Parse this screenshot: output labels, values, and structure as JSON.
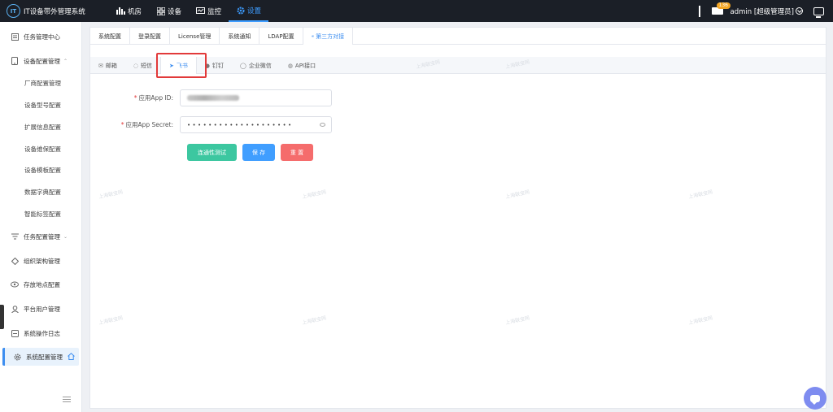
{
  "app": {
    "title": "IT设备带外管理系统",
    "logo": "IT"
  },
  "nav": [
    {
      "label": "机房",
      "icon": "bar-chart-icon"
    },
    {
      "label": "设备",
      "icon": "grid-icon"
    },
    {
      "label": "监控",
      "icon": "monitor-icon"
    },
    {
      "label": "设置",
      "icon": "gear-icon"
    }
  ],
  "header": {
    "badge": "136",
    "user": "admin [超级管理员]"
  },
  "sidebar": {
    "items": [
      {
        "label": "任务管理中心",
        "icon": "task-icon"
      },
      {
        "label": "设备配置管理",
        "icon": "device-icon"
      },
      {
        "label": "厂商配置管理"
      },
      {
        "label": "设备型号配置"
      },
      {
        "label": "扩展信息配置"
      },
      {
        "label": "设备维保配置"
      },
      {
        "label": "设备模板配置"
      },
      {
        "label": "数据字典配置"
      },
      {
        "label": "智能标签配置"
      },
      {
        "label": "任务配置管理",
        "icon": "filter-icon"
      },
      {
        "label": "组织架构管理",
        "icon": "org-icon"
      },
      {
        "label": "存放地点配置",
        "icon": "location-icon"
      },
      {
        "label": "平台用户管理",
        "icon": "user-icon"
      },
      {
        "label": "系统操作日志",
        "icon": "log-icon"
      },
      {
        "label": "系统配置管理",
        "icon": "settings-icon"
      }
    ]
  },
  "tabs_primary": [
    "系统配置",
    "登录配置",
    "License管理",
    "系统通知",
    "LDAP配置",
    "第三方对接"
  ],
  "tabs_secondary": [
    {
      "label": "邮箱",
      "icon": "mail-icon"
    },
    {
      "label": "短信",
      "icon": "sms-icon"
    },
    {
      "label": "飞书",
      "icon": "paper-plane-icon"
    },
    {
      "label": "钉钉",
      "icon": "dingtalk-icon"
    },
    {
      "label": "企业微信",
      "icon": "wecom-icon"
    },
    {
      "label": "API接口",
      "icon": "bulb-icon"
    }
  ],
  "form": {
    "app_id_label": "应用App ID:",
    "app_secret_label": "应用App Secret:",
    "app_secret_value": "••••••••••••••••••••"
  },
  "buttons": {
    "test": "连通性测试",
    "save": "保 存",
    "reset": "重 置"
  },
  "watermark": "上海联宝网",
  "colors": {
    "accent": "#409eff",
    "topbar": "#1b1f27",
    "test_btn": "#3cc7a0",
    "reset_btn": "#f56c6c",
    "highlight": "#e23a3a"
  }
}
